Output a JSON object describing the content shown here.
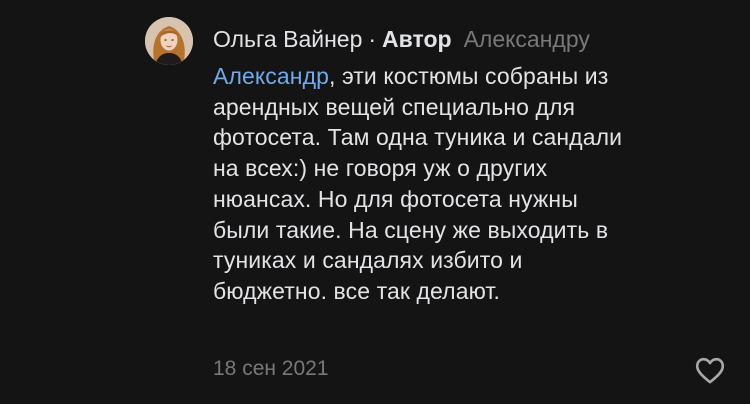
{
  "comment": {
    "author_name": "Ольга Вайнер",
    "separator": "·",
    "author_badge": "Автор",
    "reply_to": "Александру",
    "mention": "Александр",
    "text_rest": ", эти костюмы собраны из\nарендных вещей специально для\nфотосета. Там одна туника и сандали\nна всех:) не говоря уж о других\nнюансах. Но для фотосета нужны\nбыли такие. На сцену же выходить в\nтуниках и сандалях избито и\nбюджетно. все так делают.",
    "date": "18 сен 2021",
    "like_icon": "heart-outline-icon"
  },
  "colors": {
    "background": "#141414",
    "text": "#e1e3e6",
    "muted": "#76787a",
    "link": "#71aaeb"
  }
}
